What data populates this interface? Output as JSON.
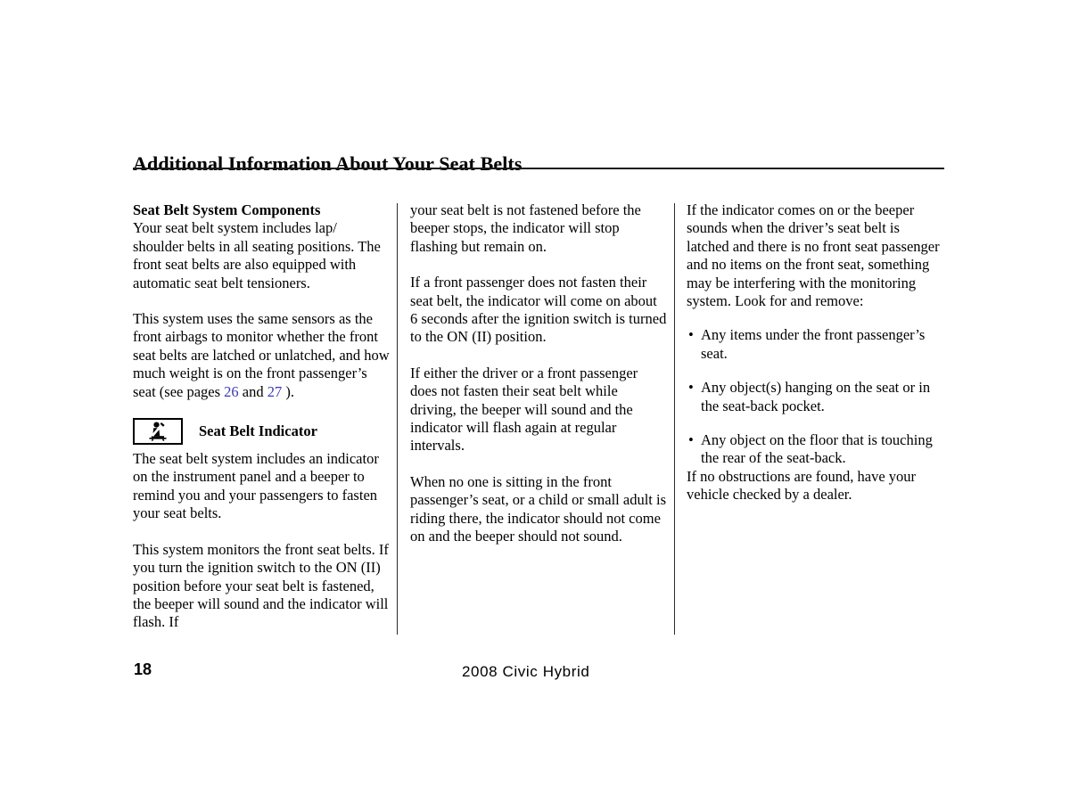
{
  "page": {
    "title": "Additional Information About Your Seat Belts",
    "page_number": "18",
    "model_footer": "2008  Civic  Hybrid",
    "link_color": "#3b3bb0"
  },
  "column1": {
    "section_heading": "Seat Belt System Components",
    "para1": "Your seat belt system includes lap/ shoulder belts in all seating positions. The front seat belts are also equipped with automatic seat belt tensioners.",
    "para2_part1": "This system uses the same sensors as the front airbags to monitor whether the front seat belts are latched or unlatched, and how much weight is on the front passenger’s seat (see pages ",
    "para2_ref1": "26",
    "para2_part2": " and ",
    "para2_ref2": "27",
    "para2_part3": " ).",
    "indicator_icon_name": "seat-belt-indicator-icon",
    "indicator_heading": "Seat Belt Indicator",
    "para3": "The seat belt system includes an indicator on the instrument panel and a beeper to remind you and your passengers to fasten your seat belts.",
    "para4": "This system monitors the front seat belts. If you turn the ignition switch to the ON (II) position before your seat belt is fastened, the beeper will sound and the indicator will flash. If"
  },
  "column2": {
    "para1": "your seat belt is not fastened before the beeper stops, the indicator will stop flashing but remain on.",
    "para2": "If a front passenger does not fasten their seat belt, the indicator will come on about 6 seconds after the ignition switch is turned to the ON (II) position.",
    "para3": "If either the driver or a front passenger does not fasten their seat belt while driving, the beeper will sound and the indicator will flash again at regular intervals.",
    "para4": "When no one is sitting in the front passenger’s seat, or a child or small adult is riding there, the indicator should not come on and the beeper should not sound."
  },
  "column3": {
    "para1": "If the indicator comes on or the beeper sounds when the driver’s seat belt is latched and there is no front seat passenger and no items on the front seat, something may be interfering with the monitoring system. Look for and remove:",
    "bullet_marker": "•",
    "bullets": [
      "Any items under the front passenger’s seat.",
      "Any object(s) hanging on the seat or in the seat-back pocket.",
      "Any object on the floor that is touching the rear of the seat-back."
    ],
    "para2": "If no obstructions are found, have your vehicle checked by a dealer."
  }
}
